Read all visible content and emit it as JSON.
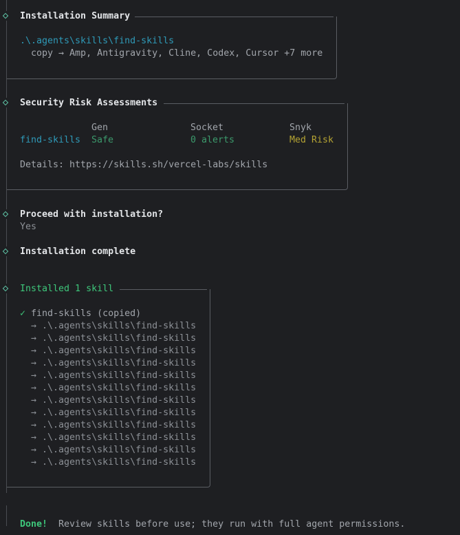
{
  "summary": {
    "title": "Installation Summary",
    "path": ".\\.agents\\skills\\find-skills",
    "copy_line": "  copy → Amp, Antigravity, Cline, Codex, Cursor +7 more"
  },
  "security": {
    "title": "Security Risk Assessments",
    "headers": [
      "Gen",
      "Socket",
      "Snyk"
    ],
    "skill": "find-skills",
    "gen": "Safe",
    "socket": "0 alerts",
    "snyk": "Med Risk",
    "details": "Details: https://skills.sh/vercel-labs/skills"
  },
  "proceed": {
    "question": "Proceed with installation?",
    "answer": "Yes"
  },
  "complete": "Installation complete",
  "installed": {
    "title": "Installed 1 skill",
    "check": "✓",
    "skill_line": "find-skills (copied)",
    "paths": [
      "  → .\\.agents\\skills\\find-skills",
      "  → .\\.agents\\skills\\find-skills",
      "  → .\\.agents\\skills\\find-skills",
      "  → .\\.agents\\skills\\find-skills",
      "  → .\\.agents\\skills\\find-skills",
      "  → .\\.agents\\skills\\find-skills",
      "  → .\\.agents\\skills\\find-skills",
      "  → .\\.agents\\skills\\find-skills",
      "  → .\\.agents\\skills\\find-skills",
      "  → .\\.agents\\skills\\find-skills",
      "  → .\\.agents\\skills\\find-skills",
      "  → .\\.agents\\skills\\find-skills"
    ]
  },
  "done": {
    "label": "Done!",
    "message": "Review skills before use; they run with full agent permissions."
  }
}
